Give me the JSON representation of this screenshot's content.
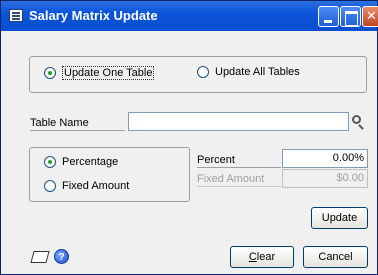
{
  "window": {
    "title": "Salary Matrix Update",
    "title_icon": "table-icon"
  },
  "scope": {
    "options": [
      {
        "label": "Update One Table",
        "selected": true
      },
      {
        "label": "Update All Tables",
        "selected": false
      }
    ]
  },
  "table_name": {
    "label": "Table Name",
    "value": "",
    "lookup_icon": "magnifier-icon"
  },
  "method": {
    "options": [
      {
        "label": "Percentage",
        "selected": true
      },
      {
        "label": "Fixed Amount",
        "selected": false
      }
    ]
  },
  "percent": {
    "label": "Percent",
    "value": "0.00%"
  },
  "fixed_amount": {
    "label": "Fixed Amount",
    "value": "$0.00",
    "disabled": true
  },
  "buttons": {
    "update": "Update",
    "clear": "Clear",
    "clear_mnemonic": "C",
    "clear_rest": "lear",
    "cancel": "Cancel"
  },
  "footer_icons": [
    "note-icon",
    "help-icon"
  ],
  "colors": {
    "titlebar": "#0b54d8",
    "window_bg": "#f0f0f0",
    "radio_dot": "#21a121",
    "close_button": "#c4431f"
  }
}
